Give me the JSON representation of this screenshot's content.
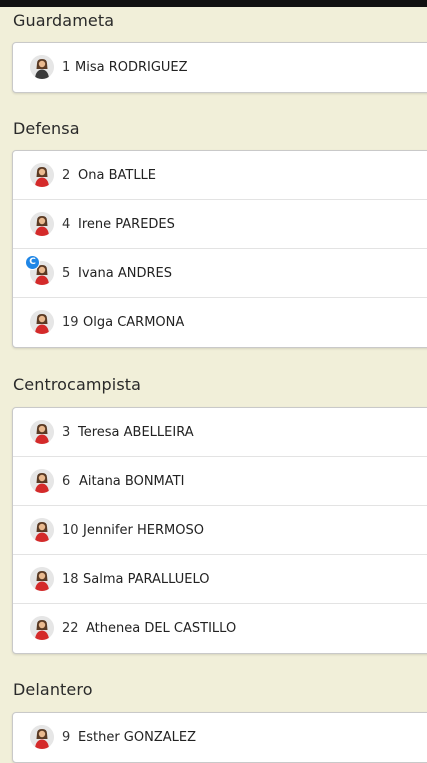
{
  "sections": [
    {
      "title": "Guardameta",
      "players": [
        {
          "number": "1",
          "name": "Misa RODRIGUEZ",
          "kit": "dark"
        }
      ]
    },
    {
      "title": "Defensa",
      "players": [
        {
          "number": "2",
          "name": "Ona BATLLE",
          "kit": "red"
        },
        {
          "number": "4",
          "name": "Irene PAREDES",
          "kit": "red"
        },
        {
          "number": "5",
          "name": "Ivana ANDRES",
          "kit": "red",
          "captain": "C"
        },
        {
          "number": "19",
          "name": "Olga CARMONA",
          "kit": "red"
        }
      ]
    },
    {
      "title": "Centrocampista",
      "players": [
        {
          "number": "3",
          "name": "Teresa ABELLEIRA",
          "kit": "red"
        },
        {
          "number": "6",
          "name": "Aitana BONMATI",
          "kit": "red"
        },
        {
          "number": "10",
          "name": "Jennifer HERMOSO",
          "kit": "red"
        },
        {
          "number": "18",
          "name": "Salma PARALLUELO",
          "kit": "red"
        },
        {
          "number": "22",
          "name": "Athenea DEL CASTILLO",
          "kit": "red"
        }
      ]
    },
    {
      "title": "Delantero",
      "players": [
        {
          "number": "9",
          "name": "Esther GONZALEZ",
          "kit": "red"
        }
      ]
    }
  ],
  "colors": {
    "background": "#f1efd9",
    "kit_red": "#d42a2a",
    "kit_dark": "#3a3a3a",
    "captain_badge": "#1f86e6"
  }
}
